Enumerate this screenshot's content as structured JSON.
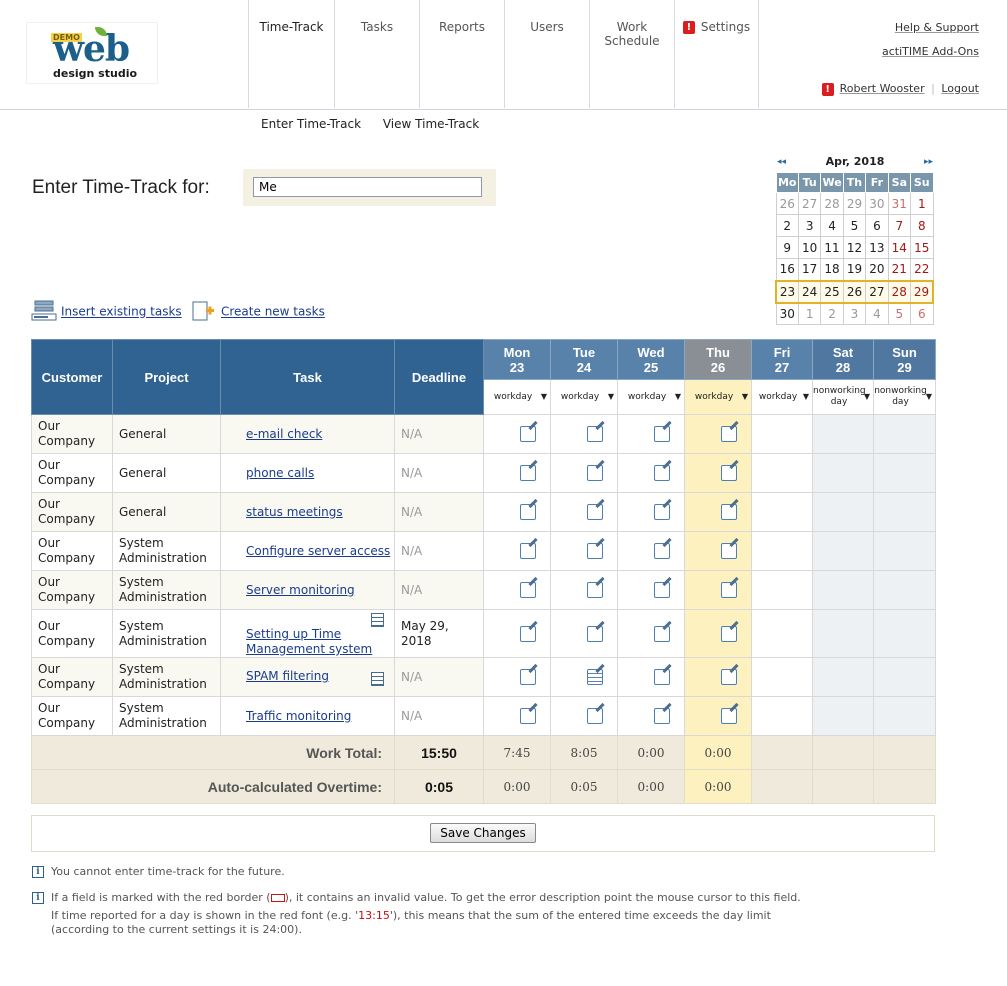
{
  "logo": {
    "demo": "DEMO",
    "web": "web",
    "sub": "design studio"
  },
  "nav": [
    {
      "label": "Time-Track",
      "warn": false
    },
    {
      "label": "Tasks",
      "warn": false
    },
    {
      "label": "Reports",
      "warn": false
    },
    {
      "label": "Users",
      "warn": false
    },
    {
      "label": "Work Schedule",
      "warn": false
    },
    {
      "label": "Settings",
      "warn": true
    }
  ],
  "top_links": {
    "help": "Help & Support",
    "addons": "actiTIME Add-Ons",
    "user": "Robert Wooster",
    "logout": "Logout"
  },
  "subnav": {
    "enter": "Enter Time-Track",
    "view": "View Time-Track"
  },
  "enter_title": "Enter Time-Track for:",
  "who_value": "Me",
  "calendar": {
    "title": "Apr, 2018",
    "prev": "◂◂",
    "next": "▸▸",
    "weekdays": [
      "Mo",
      "Tu",
      "We",
      "Th",
      "Fr",
      "Sa",
      "Su"
    ],
    "weeks": [
      [
        "26",
        "27",
        "28",
        "29",
        "30",
        "31",
        "1"
      ],
      [
        "2",
        "3",
        "4",
        "5",
        "6",
        "7",
        "8"
      ],
      [
        "9",
        "10",
        "11",
        "12",
        "13",
        "14",
        "15"
      ],
      [
        "16",
        "17",
        "18",
        "19",
        "20",
        "21",
        "22"
      ],
      [
        "23",
        "24",
        "25",
        "26",
        "27",
        "28",
        "29"
      ],
      [
        "30",
        "1",
        "2",
        "3",
        "4",
        "5",
        "6"
      ]
    ]
  },
  "actions": {
    "insert": "Insert existing tasks",
    "create": "Create new tasks"
  },
  "grid": {
    "headers": {
      "customer": "Customer",
      "project": "Project",
      "task": "Task",
      "deadline": "Deadline"
    },
    "days": [
      {
        "name": "Mon",
        "num": "23",
        "type": "workday"
      },
      {
        "name": "Tue",
        "num": "24",
        "type": "workday"
      },
      {
        "name": "Wed",
        "num": "25",
        "type": "workday"
      },
      {
        "name": "Thu",
        "num": "26",
        "type": "workday"
      },
      {
        "name": "Fri",
        "num": "27",
        "type": "workday"
      },
      {
        "name": "Sat",
        "num": "28",
        "type": "nonworking day"
      },
      {
        "name": "Sun",
        "num": "29",
        "type": "nonworking day"
      }
    ],
    "rows": [
      {
        "customer": "Our Company",
        "project": "General",
        "task": "e-mail check",
        "deadline": "N/A"
      },
      {
        "customer": "Our Company",
        "project": "General",
        "task": "phone calls",
        "deadline": "N/A"
      },
      {
        "customer": "Our Company",
        "project": "General",
        "task": "status meetings",
        "deadline": "N/A"
      },
      {
        "customer": "Our Company",
        "project": "System Administration",
        "task": "Configure server access",
        "deadline": "N/A"
      },
      {
        "customer": "Our Company",
        "project": "System Administration",
        "task": "Server monitoring",
        "deadline": "N/A"
      },
      {
        "customer": "Our Company",
        "project": "System Administration",
        "task": "Setting up Time Management system",
        "deadline": "May 29, 2018"
      },
      {
        "customer": "Our Company",
        "project": "System Administration",
        "task": "SPAM filtering",
        "deadline": "N/A"
      },
      {
        "customer": "Our Company",
        "project": "System Administration",
        "task": "Traffic monitoring",
        "deadline": "N/A"
      }
    ],
    "work_total": {
      "label": "Work Total:",
      "value": "15:50",
      "days": [
        "7:45",
        "8:05",
        "0:00",
        "0:00"
      ]
    },
    "overtime": {
      "label": "Auto-calculated Overtime:",
      "value": "0:05",
      "days": [
        "0:00",
        "0:05",
        "0:00",
        "0:00"
      ]
    }
  },
  "save_label": "Save Changes",
  "notes": {
    "future": "You cannot enter time-track for the future.",
    "red_a": "If a field is marked with the red border (",
    "red_b": "), it contains an invalid value. To get the error description point the mouse cursor to this field.",
    "font_a": "If time reported for a day is shown in the red font (e.g. '",
    "font_example": "13:15",
    "font_b": "'), this means that the sum of the entered time exceeds the day limit",
    "font_c": "(according to the current settings it is 24:00)."
  }
}
